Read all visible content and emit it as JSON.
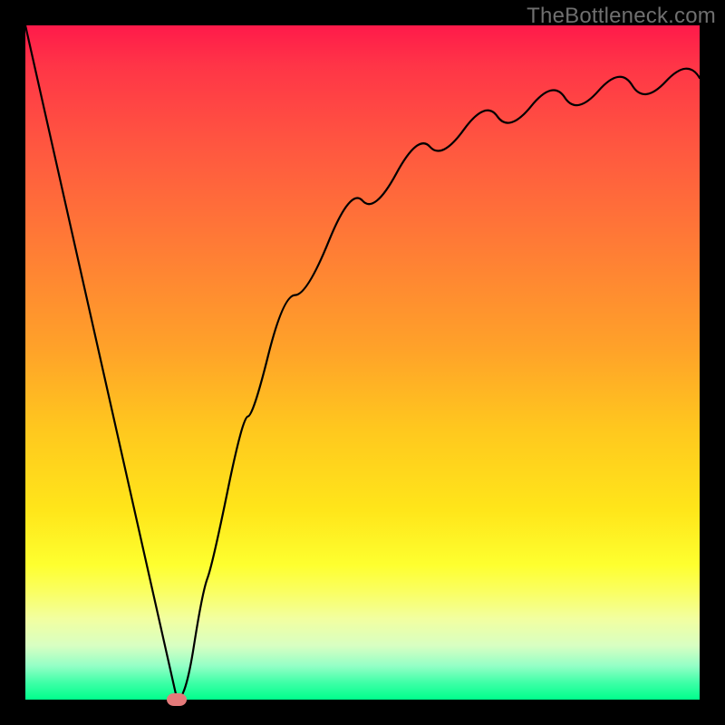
{
  "watermark": "TheBottleneck.com",
  "domain": "Chart",
  "chart_data": {
    "type": "line",
    "title": "",
    "xlabel": "",
    "ylabel": "",
    "xlim": [
      0,
      100
    ],
    "ylim": [
      0,
      100
    ],
    "x": [
      0,
      5,
      10,
      15,
      20,
      22.5,
      25,
      27,
      30,
      33,
      36,
      40,
      45,
      50,
      55,
      60,
      65,
      70,
      75,
      80,
      85,
      90,
      95,
      100
    ],
    "y": [
      100,
      78,
      56,
      33,
      11,
      0,
      8,
      18,
      31,
      42,
      51,
      60,
      68,
      74,
      78,
      82,
      84.5,
      86.5,
      88,
      89.3,
      90.3,
      91.1,
      91.7,
      92.2
    ],
    "min_point": {
      "x": 22.5,
      "y": 0
    },
    "curve_color": "#000000",
    "background": "rainbow-gradient-red-to-green-vertical",
    "marker": {
      "shape": "pill",
      "color": "#e47a7a",
      "x": 22.5,
      "y": 0
    }
  }
}
